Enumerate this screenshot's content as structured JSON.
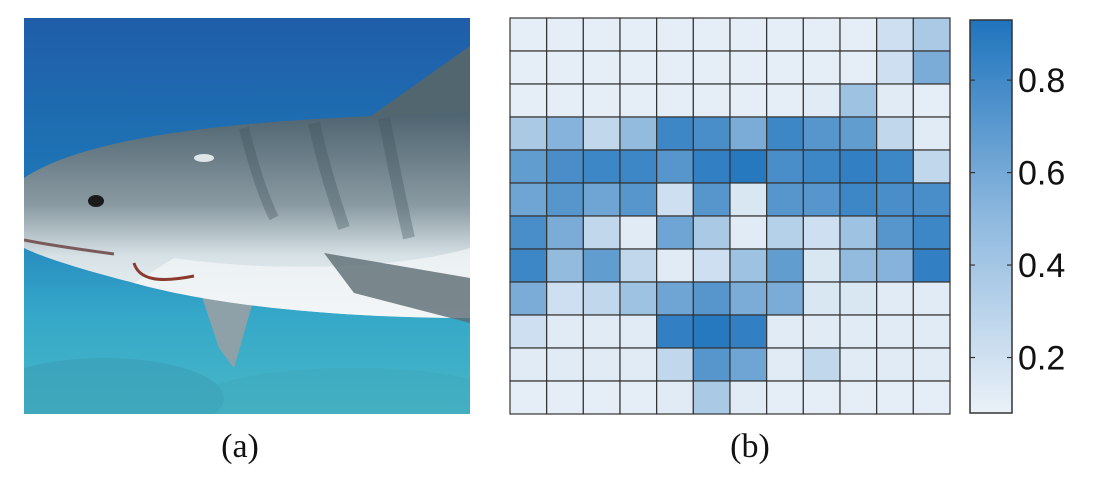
{
  "captions": {
    "a": "(a)",
    "b": "(b)"
  },
  "colors": {
    "low": "#e8eff7",
    "high": "#1f74bd",
    "grid": "#333333"
  },
  "chart_data": {
    "type": "heatmap",
    "rows": 12,
    "cols": 12,
    "colorbar": {
      "ticks": [
        0.2,
        0.4,
        0.6,
        0.8
      ],
      "range": [
        0.08,
        0.93
      ]
    },
    "values": [
      [
        0.1,
        0.1,
        0.1,
        0.1,
        0.1,
        0.1,
        0.1,
        0.1,
        0.1,
        0.1,
        0.2,
        0.35
      ],
      [
        0.1,
        0.1,
        0.1,
        0.1,
        0.1,
        0.1,
        0.1,
        0.1,
        0.1,
        0.1,
        0.2,
        0.55
      ],
      [
        0.1,
        0.1,
        0.1,
        0.1,
        0.1,
        0.1,
        0.1,
        0.1,
        0.12,
        0.4,
        0.12,
        0.1
      ],
      [
        0.35,
        0.5,
        0.25,
        0.45,
        0.8,
        0.75,
        0.55,
        0.8,
        0.7,
        0.65,
        0.25,
        0.12
      ],
      [
        0.65,
        0.75,
        0.8,
        0.8,
        0.7,
        0.85,
        0.9,
        0.75,
        0.8,
        0.85,
        0.8,
        0.25
      ],
      [
        0.6,
        0.7,
        0.6,
        0.7,
        0.2,
        0.7,
        0.15,
        0.7,
        0.7,
        0.8,
        0.75,
        0.75
      ],
      [
        0.75,
        0.55,
        0.25,
        0.12,
        0.6,
        0.35,
        0.12,
        0.3,
        0.2,
        0.4,
        0.7,
        0.8
      ],
      [
        0.8,
        0.45,
        0.65,
        0.25,
        0.12,
        0.2,
        0.4,
        0.65,
        0.15,
        0.45,
        0.5,
        0.85
      ],
      [
        0.55,
        0.2,
        0.25,
        0.4,
        0.6,
        0.7,
        0.55,
        0.55,
        0.15,
        0.15,
        0.12,
        0.12
      ],
      [
        0.2,
        0.12,
        0.12,
        0.12,
        0.85,
        0.9,
        0.85,
        0.12,
        0.12,
        0.12,
        0.12,
        0.12
      ],
      [
        0.12,
        0.12,
        0.12,
        0.12,
        0.25,
        0.7,
        0.6,
        0.12,
        0.25,
        0.12,
        0.12,
        0.12
      ],
      [
        0.1,
        0.1,
        0.1,
        0.1,
        0.12,
        0.35,
        0.12,
        0.1,
        0.1,
        0.1,
        0.1,
        0.1
      ]
    ]
  }
}
